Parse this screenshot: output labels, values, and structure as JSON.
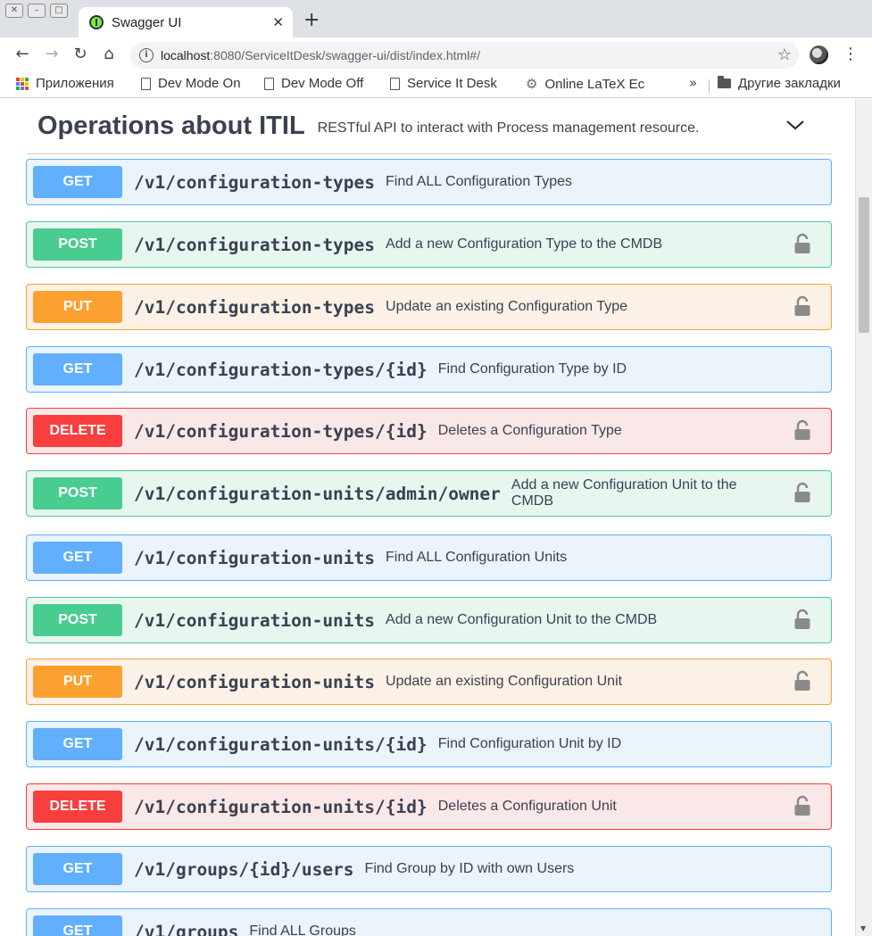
{
  "browser": {
    "tab_title": "Swagger UI",
    "url_host": "localhost",
    "url_rest": ":8080/ServiceItDesk/swagger-ui/dist/index.html#/",
    "bookmarks": [
      {
        "label": "Приложения",
        "icon": "apps-icon"
      },
      {
        "label": "Dev Mode On",
        "icon": "page-icon"
      },
      {
        "label": "Dev Mode Off",
        "icon": "page-icon"
      },
      {
        "label": "Service It Desk",
        "icon": "page-icon"
      },
      {
        "label": "Online LaTeX Ec",
        "icon": "gear-icon"
      }
    ],
    "overflow": "»",
    "other_bookmarks": "Другие закладки"
  },
  "section": {
    "name": "Operations about ITIL",
    "description": "RESTful API to interact with Process management resource."
  },
  "operations": [
    {
      "method": "GET",
      "path": "/v1/configuration-types",
      "summary": "Find ALL Configuration Types",
      "locked": false
    },
    {
      "method": "POST",
      "path": "/v1/configuration-types",
      "summary": "Add a new Configuration Type to the CMDB",
      "locked": true
    },
    {
      "method": "PUT",
      "path": "/v1/configuration-types",
      "summary": "Update an existing Configuration Type",
      "locked": true
    },
    {
      "method": "GET",
      "path": "/v1/configuration-types/{id}",
      "summary": "Find Configuration Type by ID",
      "locked": false
    },
    {
      "method": "DELETE",
      "path": "/v1/configuration-types/{id}",
      "summary": "Deletes a Configuration Type",
      "locked": true
    },
    {
      "method": "POST",
      "path": "/v1/configuration-units/admin/owner",
      "summary": "Add a new Configuration Unit to the CMDB",
      "locked": true
    },
    {
      "method": "GET",
      "path": "/v1/configuration-units",
      "summary": "Find ALL Configuration Units",
      "locked": false
    },
    {
      "method": "POST",
      "path": "/v1/configuration-units",
      "summary": "Add a new Configuration Unit to the CMDB",
      "locked": true
    },
    {
      "method": "PUT",
      "path": "/v1/configuration-units",
      "summary": "Update an existing Configuration Unit",
      "locked": true
    },
    {
      "method": "GET",
      "path": "/v1/configuration-units/{id}",
      "summary": "Find Configuration Unit by ID",
      "locked": false
    },
    {
      "method": "DELETE",
      "path": "/v1/configuration-units/{id}",
      "summary": "Deletes a Configuration Unit",
      "locked": true
    },
    {
      "method": "GET",
      "path": "/v1/groups/{id}/users",
      "summary": "Find Group by ID with own Users",
      "locked": false
    },
    {
      "method": "GET",
      "path": "/v1/groups",
      "summary": "Find ALL Groups",
      "locked": false
    }
  ],
  "colors": {
    "get": "#61affe",
    "post": "#49cc90",
    "put": "#fca130",
    "delete": "#f93e3e",
    "text": "#3b4151"
  }
}
